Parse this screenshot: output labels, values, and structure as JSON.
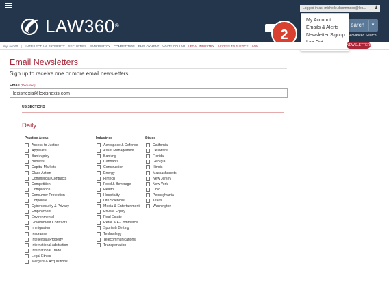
{
  "header": {
    "logo_text": "LAW360",
    "logo_reg": "®",
    "login_text": "Logged in as: michelle.dicommoso@lex...",
    "search_label": "earch",
    "search_caret": "▾",
    "advanced_search": "Advanced Search",
    "badge_number": "2"
  },
  "account_menu": {
    "items": [
      "My Account",
      "Emails & Alerts",
      "Newsletter Signup",
      "Log Out"
    ]
  },
  "nav": {
    "items": [
      "myLaw360",
      "|",
      "INTELLECTUAL PROPERTY",
      "SECURITIES",
      "BANKRUPTCY",
      "COMPETITION",
      "EMPLOYMENT",
      "WHITE COLLAR",
      "LEGAL INDUSTRY",
      "ACCESS TO JUSTICE",
      "LAW..."
    ],
    "red_items": [
      8,
      9,
      10
    ],
    "newsletters_button": "NEWSLETTERS"
  },
  "page": {
    "title": "Email Newsletters",
    "subtitle": "Sign up to receive one or more email newsletters",
    "email_label": "Email",
    "email_required": "(Required)",
    "email_value": "lexisnexis@lexisnexis.com",
    "section_heading": "US SECTIONS",
    "frequency_heading": "Daily"
  },
  "columns": {
    "practice_areas": {
      "heading": "Practice Areas",
      "items": [
        "Access to Justice",
        "Appellate",
        "Bankruptcy",
        "Benefits",
        "Capital Markets",
        "Class Action",
        "Commercial Contracts",
        "Competition",
        "Compliance",
        "Consumer Protection",
        "Corporate",
        "Cybersecurity & Privacy",
        "Employment",
        "Environmental",
        "Government Contracts",
        "Immigration",
        "Insurance",
        "Intellectual Property",
        "International Arbitration",
        "International Trade",
        "Legal Ethics",
        "Mergers & Acquisitions"
      ]
    },
    "industries": {
      "heading": "Industries",
      "items": [
        "Aerospace & Defense",
        "Asset Management",
        "Banking",
        "Cannabis",
        "Construction",
        "Energy",
        "Fintech",
        "Food & Beverage",
        "Health",
        "Hospitality",
        "Life Sciences",
        "Media & Entertainment",
        "Private Equity",
        "Real Estate",
        "Retail & E-Commerce",
        "Sports & Betting",
        "Technology",
        "Telecommunications",
        "Transportation"
      ]
    },
    "states": {
      "heading": "States",
      "items": [
        "California",
        "Delaware",
        "Florida",
        "Georgia",
        "Illinois",
        "Massachusetts",
        "New Jersey",
        "New York",
        "Ohio",
        "Pennsylvania",
        "Texas",
        "Washington"
      ]
    }
  },
  "colors": {
    "header_bg": "#24364c",
    "accent_red": "#a8283a",
    "badge_red": "#d9402f"
  }
}
